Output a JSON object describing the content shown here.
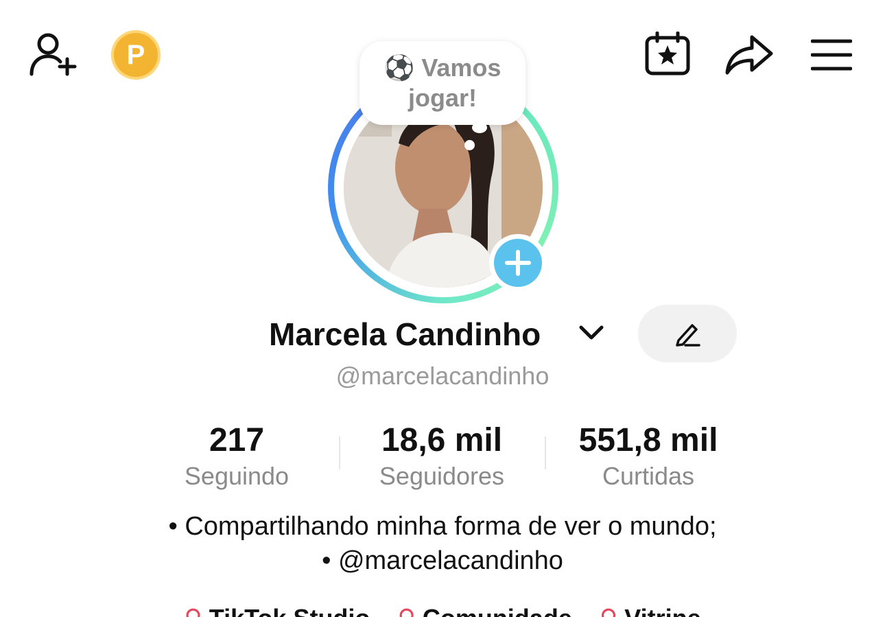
{
  "topbar": {
    "add_friend_icon": "person-plus-icon",
    "points_badge": "P",
    "calendar_icon": "calendar-star-icon",
    "share_icon": "share-arrow-icon",
    "menu_icon": "hamburger-menu-icon"
  },
  "status_bubble": {
    "emoji": "⚽",
    "text_line1": "Vamos",
    "text_line2": "jogar!"
  },
  "profile": {
    "name": "Marcela Candinho",
    "handle": "@marcelacandinho"
  },
  "stats": [
    {
      "value": "217",
      "label": "Seguindo"
    },
    {
      "value": "18,6 mil",
      "label": "Seguidores"
    },
    {
      "value": "551,8 mil",
      "label": "Curtidas"
    }
  ],
  "bio": {
    "line1": "• Compartilhando minha forma de ver o mundo;",
    "line2": "• @marcelacandinho"
  },
  "links": {
    "item1": "TikTok Studio",
    "item2": "Comunidade",
    "item3": "Vitrine"
  },
  "colors": {
    "accent_blue": "#5bc2ee",
    "ring_gradient_start": "#3f8df0",
    "ring_gradient_end": "#7ef0b4",
    "points_gold": "#f2b431",
    "link_pin": "#e5475b"
  }
}
